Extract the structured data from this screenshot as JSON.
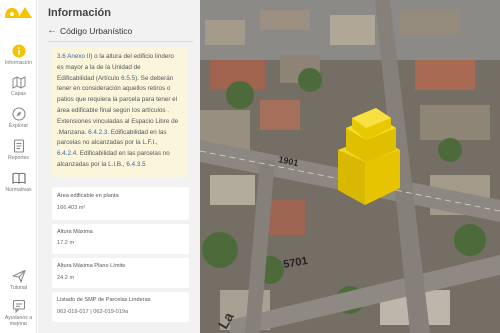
{
  "panel": {
    "title": "Información",
    "section": "Código Urbanístico"
  },
  "note": {
    "lines": [
      {
        "parts": [
          {
            "t": "3.6 Anexo II",
            "link": true
          },
          {
            "t": ") o la altura del edificio lindero"
          }
        ]
      },
      {
        "parts": [
          {
            "t": "es mayor a la de la Unidad de"
          }
        ]
      },
      {
        "parts": [
          {
            "t": "Edificabilidad (Artículo "
          },
          {
            "t": "6.5.5",
            "link": true
          },
          {
            "t": "). Se deberán"
          }
        ]
      },
      {
        "parts": [
          {
            "t": "tener en consideración aquellos retiros o"
          }
        ]
      },
      {
        "parts": [
          {
            "t": "patios que requiera la parcela para tener el"
          }
        ]
      },
      {
        "parts": [
          {
            "t": "área edificable final según los artículos ."
          }
        ]
      },
      {
        "parts": [
          {
            "t": "Extensiones vinculadas al Espacio Libre de"
          }
        ]
      },
      {
        "parts": [
          {
            "t": ".Manzana. "
          },
          {
            "t": "6.4.2.3",
            "link": true
          },
          {
            "t": ". Edificabilidad en las"
          }
        ]
      },
      {
        "parts": [
          {
            "t": "parcelas no alcanzadas por la L.F.I.,"
          }
        ]
      },
      {
        "parts": [
          {
            "t": "6.4.2.4",
            "link": true
          },
          {
            "t": ". Edificabilidad en las parcelas no"
          }
        ]
      },
      {
        "parts": [
          {
            "t": "alcanzadas por la L.I.B., "
          },
          {
            "t": "6.4.3.5",
            "link": true
          }
        ]
      }
    ]
  },
  "cards": [
    {
      "label": "Área edificable en planta",
      "value": "166.403 m²"
    },
    {
      "label": "Altura Máxima",
      "value": "17.2 m"
    },
    {
      "label": "Altura Máxima Plano Límite",
      "value": "24.2 m"
    },
    {
      "label": "Listado de SMP de Parcelas Linderas",
      "value": "062-019-017 | 062-019-019a"
    }
  ],
  "nav": [
    {
      "label": "Información",
      "icon": "info-icon",
      "active": true
    },
    {
      "label": "Capas",
      "icon": "layers-icon"
    },
    {
      "label": "Explorar",
      "icon": "compass-icon"
    },
    {
      "label": "Reportes",
      "icon": "report-icon"
    },
    {
      "label": "Normativas",
      "icon": "book-icon"
    },
    {
      "label": "Tutorial",
      "icon": "send-icon"
    },
    {
      "label": "Ayudanos a mejorar",
      "icon": "feedback-icon"
    }
  ],
  "map_labels": {
    "street_number_1": "1901",
    "street_number_2": "5701",
    "street_fragment": "La"
  },
  "colors": {
    "accent": "#f5c400",
    "link": "#2b6cb0",
    "note_bg": "#fbf5dc",
    "building": "#e6c400"
  }
}
